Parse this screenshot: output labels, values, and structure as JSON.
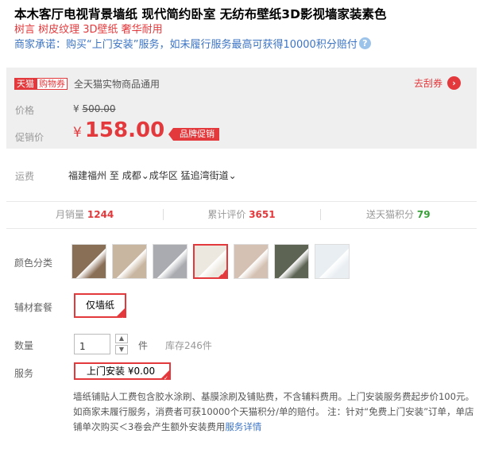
{
  "product": {
    "title": "本木客厅电视背景墙纸 现代简约卧室 无纺布壁纸3D影视墙家装素色",
    "subtitle": "树言 树皮纹理 3D壁纸 奢华耐用",
    "promise": "商家承诺：购买“上门安装”服务，如未履行服务最高可获得10000积分赔付",
    "promise_icon": "help-icon"
  },
  "promo": {
    "tag_tmall": "天猫",
    "tag_shop": "购物券",
    "coupon_desc": "全天猫实物商品通用",
    "coupon_link": "去刮券",
    "price_label": "价格",
    "price_currency": "¥",
    "price_old": "500.00",
    "promo_label": "促销价",
    "promo_currency": "¥",
    "promo_price": "158.00",
    "brand_badge": "品牌促销"
  },
  "shipping": {
    "label": "运费",
    "from": "福建福州",
    "to_word": "至",
    "city": "成都",
    "district": "成华区",
    "street": "猛追湾街道"
  },
  "stats": {
    "monthly_sales_label": "月销量",
    "monthly_sales": "1244",
    "reviews_label": "累计评价",
    "reviews": "3651",
    "points_label": "送天猫积分",
    "points": "79"
  },
  "color": {
    "label": "颜色分类",
    "selected_index": 3,
    "swatches": [
      {
        "name": "brown-swatch",
        "color": "#8a6f57"
      },
      {
        "name": "beige-swatch",
        "color": "#c8b6a1"
      },
      {
        "name": "gray-swatch",
        "color": "#a9abb0"
      },
      {
        "name": "white-swatch",
        "color": "#ece8df"
      },
      {
        "name": "pink-beige-swatch",
        "color": "#d4c1b3"
      },
      {
        "name": "dark-green-swatch",
        "color": "#5e6454"
      },
      {
        "name": "sample-swatch",
        "color": "#e9eef2"
      }
    ]
  },
  "accessory": {
    "label": "辅材套餐",
    "option": "仅墙纸"
  },
  "quantity": {
    "label": "数量",
    "value": "1",
    "unit": "件",
    "stock": "库存246件"
  },
  "service": {
    "label": "服务",
    "option": "上门安装 ¥0.00",
    "desc": "墙纸铺贴人工费包含胶水涂刷、基膜涂刷及铺贴费，不含辅料费用。上门安装服务费起步价100元。如商家未履行服务，消费者可获10000个天猫积分/单的赔付。 注：针对“免费上门安装”订单，单店铺单次购买＜3卷会产生额外安装费用",
    "detail_link": "服务详情"
  },
  "accent_red": "#e4393c",
  "link_blue": "#3c74c4"
}
